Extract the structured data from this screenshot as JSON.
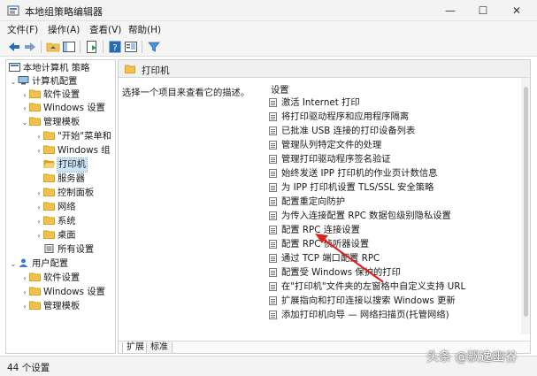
{
  "window": {
    "title": "本地组策略编辑器",
    "minimize_glyph": "—",
    "maximize_glyph": "☐",
    "close_glyph": "✕"
  },
  "menu": {
    "items": [
      "文件(F)",
      "操作(A)",
      "查看(V)",
      "帮助(H)"
    ]
  },
  "toolbar": {
    "icons": [
      "back-icon",
      "forward-icon",
      "up-folder-icon",
      "show-hide-tree-icon",
      "export-list-icon",
      "help-icon",
      "properties-icon",
      "filter-icon"
    ]
  },
  "tree": {
    "items": [
      {
        "label": "本地计算机 策略",
        "chevron": "",
        "kind": "computer"
      },
      {
        "label": "计算机配置",
        "chevron": "⌄",
        "kind": "computer"
      },
      {
        "label": "软件设置",
        "chevron": "›",
        "kind": "folder"
      },
      {
        "label": "Windows 设置",
        "chevron": "›",
        "kind": "folder"
      },
      {
        "label": "管理模板",
        "chevron": "⌄",
        "kind": "folder"
      },
      {
        "label": "\"开始\"菜单和",
        "chevron": "›",
        "kind": "folder"
      },
      {
        "label": "Windows 组",
        "chevron": "›",
        "kind": "folder"
      },
      {
        "label": "打印机",
        "chevron": "",
        "kind": "folder-open"
      },
      {
        "label": "服务器",
        "chevron": "",
        "kind": "folder"
      },
      {
        "label": "控制面板",
        "chevron": "›",
        "kind": "folder"
      },
      {
        "label": "网络",
        "chevron": "›",
        "kind": "folder"
      },
      {
        "label": "系统",
        "chevron": "›",
        "kind": "folder"
      },
      {
        "label": "桌面",
        "chevron": "›",
        "kind": "folder"
      },
      {
        "label": "所有设置",
        "chevron": "",
        "kind": "settings"
      },
      {
        "label": "用户配置",
        "chevron": "⌄",
        "kind": "user"
      },
      {
        "label": "软件设置",
        "chevron": "›",
        "kind": "folder"
      },
      {
        "label": "Windows 设置",
        "chevron": "›",
        "kind": "folder"
      },
      {
        "label": "管理模板",
        "chevron": "›",
        "kind": "folder"
      }
    ]
  },
  "right": {
    "header_title": "打印机",
    "description": "选择一个项目来查看它的描述。",
    "column_header": "设置",
    "settings": [
      "激活 Internet 打印",
      "将打印驱动程序和应用程序隔离",
      "已批准 USB 连接的打印设备列表",
      "管理队列特定文件的处理",
      "管理打印驱动程序签名验证",
      "始终发送 IPP 打印机的作业页计数信息",
      "为 IPP 打印机设置 TLS/SSL 安全策略",
      "配置重定向防护",
      "为传入连接配置 RPC 数据包级别隐私设置",
      "配置 RPC 连接设置",
      "配置 RPC 侦听器设置",
      "通过 TCP 端口配置 RPC",
      "配置受 Windows 保护的打印",
      "在\"打印机\"文件夹的左窗格中自定义支持 URL",
      "扩展指向和打印连接以搜索 Windows 更新",
      "添加打印机向导 — 网络扫描页(托管网络)"
    ],
    "tabs": [
      "扩展",
      "标准"
    ]
  },
  "status": {
    "text": "44 个设置"
  },
  "watermark": {
    "text": "头条 @飘逸幽谷"
  },
  "colors": {
    "folder": "#f2c14e",
    "folder_dark": "#d9a21b",
    "selection": "#cce4f7",
    "annotation_red": "#e02020",
    "toolbar_blue": "#2b6cb0"
  }
}
